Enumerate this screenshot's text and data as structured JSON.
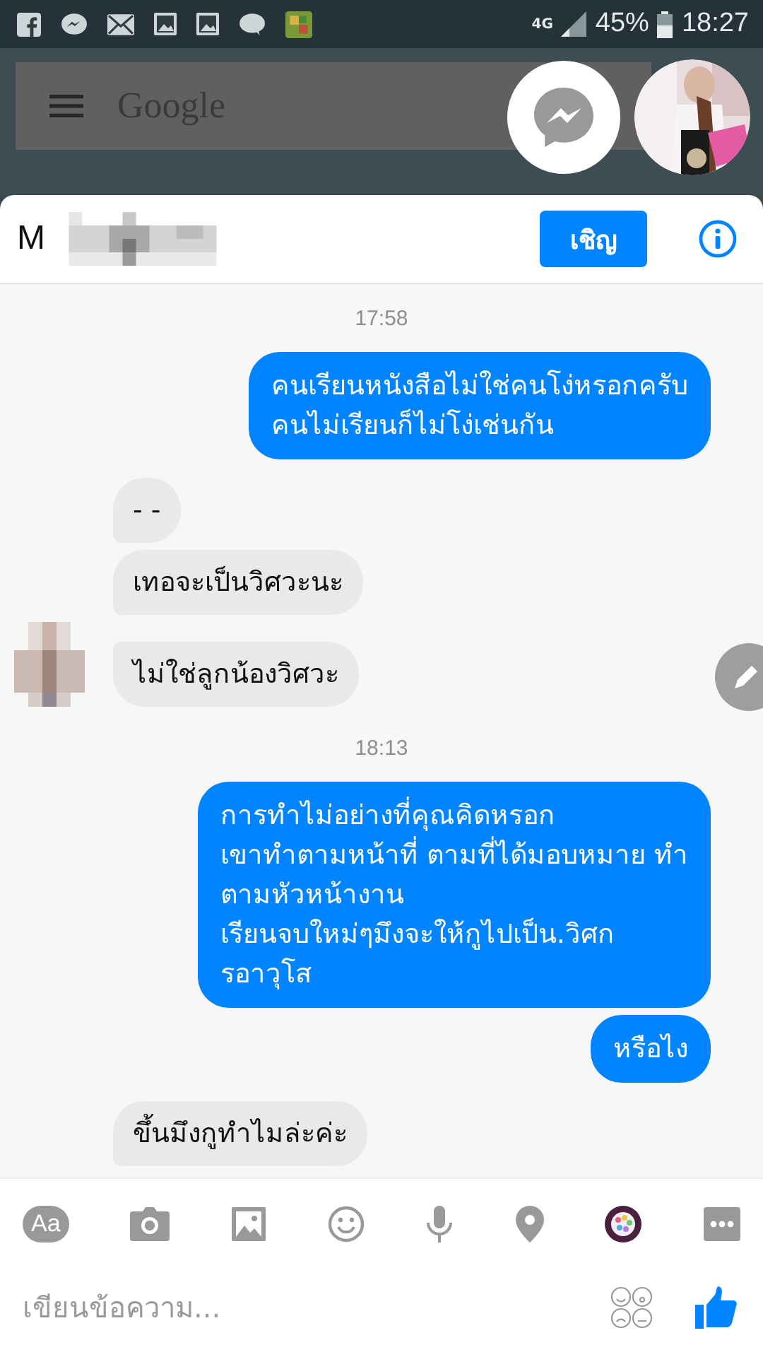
{
  "status_bar": {
    "network": "4G",
    "battery": "45%",
    "time": "18:27"
  },
  "background": {
    "search_logo": "Google"
  },
  "chat": {
    "title": "M",
    "invite_button": "เชิญ"
  },
  "messages": [
    {
      "kind": "time",
      "text": "17:58"
    },
    {
      "kind": "sent",
      "text": "คนเรียนหนังสือไม่ใช่คนโง่หรอกครับ\nคนไม่เรียนก็ไม่โง่เช่นกัน"
    },
    {
      "kind": "received",
      "text": "- -",
      "avatar": false
    },
    {
      "kind": "received",
      "text": "เทอจะเป็นวิศวะนะ",
      "avatar": false
    },
    {
      "kind": "received",
      "text": "ไม่ใช่ลูกน้องวิศวะ",
      "avatar": true
    },
    {
      "kind": "time",
      "text": "18:13"
    },
    {
      "kind": "sent",
      "text": "การทำไม่อย่างที่คุณคิดหรอก\nเขาทำตามหน้าที่ ตามที่ได้มอบหมาย ทำ\nตามหัวหน้างาน\nเรียนจบใหม่ๆมึงจะให้กูไปเป็น.วิศก\nรอาวุโส"
    },
    {
      "kind": "sent",
      "text": "หรือไง"
    },
    {
      "kind": "received",
      "text": "ขึ้นมึงกูทำไมล่ะค่ะ",
      "avatar": false
    }
  ],
  "toolbar": {
    "text_button": "Aa"
  },
  "composer": {
    "placeholder": "เขียนข้อความ..."
  }
}
